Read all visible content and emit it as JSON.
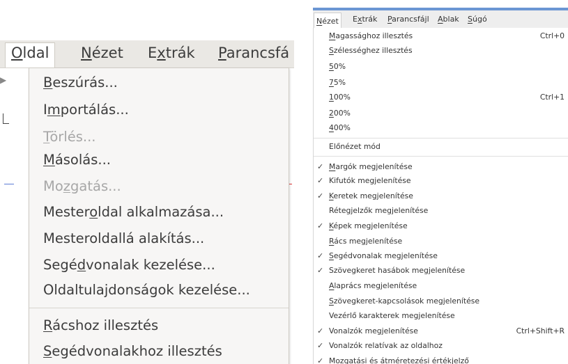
{
  "left": {
    "menubar": [
      {
        "pre": "",
        "ul": "O",
        "post": "ldal"
      },
      {
        "pre": "",
        "ul": "N",
        "post": "ézet"
      },
      {
        "pre": "E",
        "ul": "x",
        "post": "trák"
      },
      {
        "pre": "",
        "ul": "P",
        "post": "arancsfá"
      }
    ],
    "items": [
      {
        "pre": "",
        "ul": "B",
        "post": "eszúrás..."
      },
      {
        "pre": "I",
        "ul": "m",
        "post": "portálás..."
      },
      {
        "pre": "",
        "ul": "T",
        "post": "örlés..."
      },
      {
        "pre": "",
        "ul": "M",
        "post": "ásolás..."
      },
      {
        "pre": "Mo",
        "ul": "z",
        "post": "gatás..."
      },
      {
        "pre": "Mester",
        "ul": "o",
        "post": "ldal alkalmazása..."
      },
      {
        "pre": "Mesteroldallá alakítás...",
        "ul": "",
        "post": ""
      },
      {
        "pre": "Segé",
        "ul": "d",
        "post": "vonalak kezelése..."
      },
      {
        "pre": "Oldaltulajdonságok kezelése...",
        "ul": "",
        "post": ""
      },
      {
        "pre": "",
        "ul": "R",
        "post": "ácshoz illesztés"
      },
      {
        "pre": "",
        "ul": "S",
        "post": "egédvonalakhoz illesztés"
      }
    ]
  },
  "right": {
    "menubar": [
      {
        "pre": "",
        "ul": "N",
        "post": "ézet"
      },
      {
        "pre": "E",
        "ul": "x",
        "post": "trák"
      },
      {
        "pre": "",
        "ul": "P",
        "post": "arancsfájl"
      },
      {
        "pre": "",
        "ul": "A",
        "post": "blak"
      },
      {
        "pre": "",
        "ul": "S",
        "post": "úgó"
      }
    ],
    "items": [
      {
        "pre": "",
        "ul": "M",
        "post": "agassághoz illesztés",
        "accel": "Ctrl+0",
        "check": ""
      },
      {
        "pre": "",
        "ul": "S",
        "post": "zélességhez illesztés",
        "accel": "",
        "check": ""
      },
      {
        "pre": "",
        "ul": "5",
        "post": "0%",
        "accel": "",
        "check": ""
      },
      {
        "pre": "",
        "ul": "7",
        "post": "5%",
        "accel": "",
        "check": ""
      },
      {
        "pre": "",
        "ul": "1",
        "post": "00%",
        "accel": "Ctrl+1",
        "check": ""
      },
      {
        "pre": "",
        "ul": "2",
        "post": "00%",
        "accel": "",
        "check": ""
      },
      {
        "pre": "",
        "ul": "4",
        "post": "00%",
        "accel": "",
        "check": ""
      },
      {
        "pre": "Előnézet mód",
        "ul": "",
        "post": "",
        "accel": "",
        "check": ""
      },
      {
        "pre": "",
        "ul": "M",
        "post": "argók megjelenítése",
        "accel": "",
        "check": "✓"
      },
      {
        "pre": "Kifutók megjelenítése",
        "ul": "",
        "post": "",
        "accel": "",
        "check": "✓"
      },
      {
        "pre": "",
        "ul": "K",
        "post": "eretek megjelenítése",
        "accel": "",
        "check": "✓"
      },
      {
        "pre": "Rétegjelzők megjelenítése",
        "ul": "",
        "post": "",
        "accel": "",
        "check": ""
      },
      {
        "pre": "",
        "ul": "K",
        "post": "épek megjelenítése",
        "accel": "",
        "check": "✓"
      },
      {
        "pre": "",
        "ul": "R",
        "post": "ács megjelenítése",
        "accel": "",
        "check": ""
      },
      {
        "pre": "",
        "ul": "S",
        "post": "egédvonalak megjelenítése",
        "accel": "",
        "check": "✓"
      },
      {
        "pre": "Szövegkeret hasábok megjelenítése",
        "ul": "",
        "post": "",
        "accel": "",
        "check": "✓"
      },
      {
        "pre": "",
        "ul": "A",
        "post": "laprács megjelenítése",
        "accel": "",
        "check": ""
      },
      {
        "pre": "",
        "ul": "S",
        "post": "zövegkeret-kapcsolások megjelenítése",
        "accel": "",
        "check": ""
      },
      {
        "pre": "Vezérlő karakterek megjelenítése",
        "ul": "",
        "post": "",
        "accel": "",
        "check": ""
      },
      {
        "pre": "Vonalzók megjelenítése",
        "ul": "",
        "post": "",
        "accel": "Ctrl+Shift+R",
        "check": "✓"
      },
      {
        "pre": "Vonalzók relatívak az oldalhoz",
        "ul": "",
        "post": "",
        "accel": "",
        "check": "✓"
      },
      {
        "pre": "Mozgatási és átméretezési értékjelző",
        "ul": "",
        "post": "",
        "accel": "",
        "check": "✓"
      }
    ]
  }
}
